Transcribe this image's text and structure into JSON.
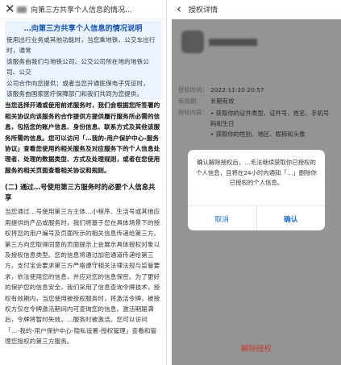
{
  "left": {
    "topbar_title": "向第三方共享个人信息的情况…",
    "heading": "…向第三方共享个人信息的情况说明",
    "intro_lines": [
      "使用出行业务或其他功能时，当您乘地铁、公交车出行时，通常",
      "该服务由我们与地铁公司、公交公司所在地的地铁公司、公交",
      "公司合作向您提供；或者当您开通医保电子凭证时，",
      "该服务由国家医疗保障部门和我们共同为您提供。"
    ],
    "bold_para": "当您选择开通或使用前述服务时，我们会根据您所签署的相关协议向该服务的合作提供方提供履行服务所必需的信息，包括您的账户信息、身份信息、联系方式及其他该服务所需的信息。您可以访问「…我的-用户保护中心-服务协议」查看您使用的相关服务及对应服务下的个人信息处理者、处理的数据类型、方式及处理规则，或者在您使用服务的相关页面查看相关协议和规则。",
    "section_title": "(二) 通过…号使用第三方服务时的必要个人信息共享",
    "body_para": "当您通过…号使用第三方主体…小程序、生活号或其他应用提供的产品或服务时，我们将基于您在具体场景下的授权将您的用户编号及页面所示的相关信息传递给第三方。第三方向您取得同意的页面提示上会展示具体授权对象以及授权信息类型。您的信息将通过加密通道传递给第三方。支付宝会要求第三方严格遵守相关法律法规与监管要求，依法使用您的信息，并应对您的信息保密。为了更好的保护您的信息安全，我们采用了信息查询令牌技术，授权有效期内，当您使用被授权服务时，将激活令牌，被授权方仅在令牌激活期间内可查询您的信息。激活期届满后，令牌将暂时失效。…服务时被激活。您可以访问「…-我的-用户保护中心-隐私设置-授权管理」查看和管理您授权的第三方服务。"
  },
  "right": {
    "topbar_title": "授权详情",
    "rows": [
      {
        "label": "授权时间：",
        "value": "2022-11-20 20:57"
      },
      {
        "label": "有效期：",
        "value": "长期有效"
      },
      {
        "label": "授权内容：",
        "value": "• 获取你的证件类型、证件号、姓名、手机号码和生日\n• 获取你的性别、地区、昵称和头像"
      }
    ],
    "dialog": {
      "message": "确认解除授权后，…毛法继续获取你已授权的个人信息，且将在24小时内通知「…」删除你已授权的个人信息。",
      "cancel_label": "取消",
      "confirm_label": "确认"
    },
    "revoke_label": "解除授权"
  },
  "colors": {
    "heading_blue": "#1a55b5",
    "dialog_blue": "#1a6fd4",
    "revoke_red": "#c83a2c"
  }
}
